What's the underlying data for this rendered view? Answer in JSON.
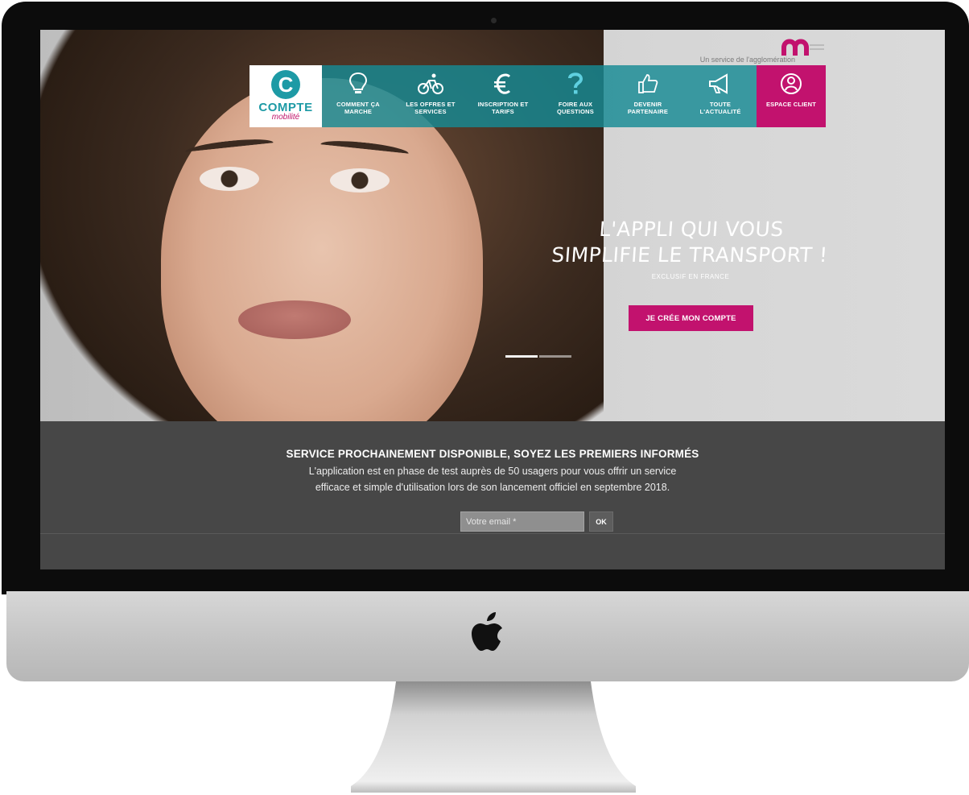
{
  "brand": {
    "logo_word": "COMPTE",
    "logo_sub": "mobilité",
    "logo_letter": "C",
    "tagline": "Un service de l'agglomération",
    "accent_teal": "#1d9aa5",
    "accent_magenta": "#c2126e"
  },
  "nav": {
    "items": [
      {
        "label": "COMMENT ÇA MARCHE",
        "icon": "lightbulb-icon"
      },
      {
        "label": "LES OFFRES ET SERVICES",
        "icon": "bicycle-icon"
      },
      {
        "label": "INSCRIPTION ET TARIFS",
        "icon": "euro-icon"
      },
      {
        "label": "FOIRE AUX QUESTIONS",
        "icon": "question-mark-icon"
      },
      {
        "label": "DEVENIR PARTENAIRE",
        "icon": "thumbs-up-icon"
      },
      {
        "label": "TOUTE L'ACTUALITÉ",
        "icon": "megaphone-icon"
      }
    ],
    "client": {
      "label": "ESPACE CLIENT",
      "icon": "user-icon"
    }
  },
  "hero": {
    "title": "L'APPLI QUI VOUS SIMPLIFIE LE TRANSPORT !",
    "subtitle": "EXCLUSIF EN FRANCE",
    "cta": "JE CRÉE MON COMPTE"
  },
  "info": {
    "title": "SERVICE PROCHAINEMENT DISPONIBLE, SOYEZ LES PREMIERS INFORMÉS",
    "body": "L'application est en phase de test auprès de 50 usagers pour vous offrir un service efficace et simple d'utilisation lors de son lancement officiel en septembre 2018.",
    "email_placeholder": "Votre email *",
    "ok": "OK"
  }
}
